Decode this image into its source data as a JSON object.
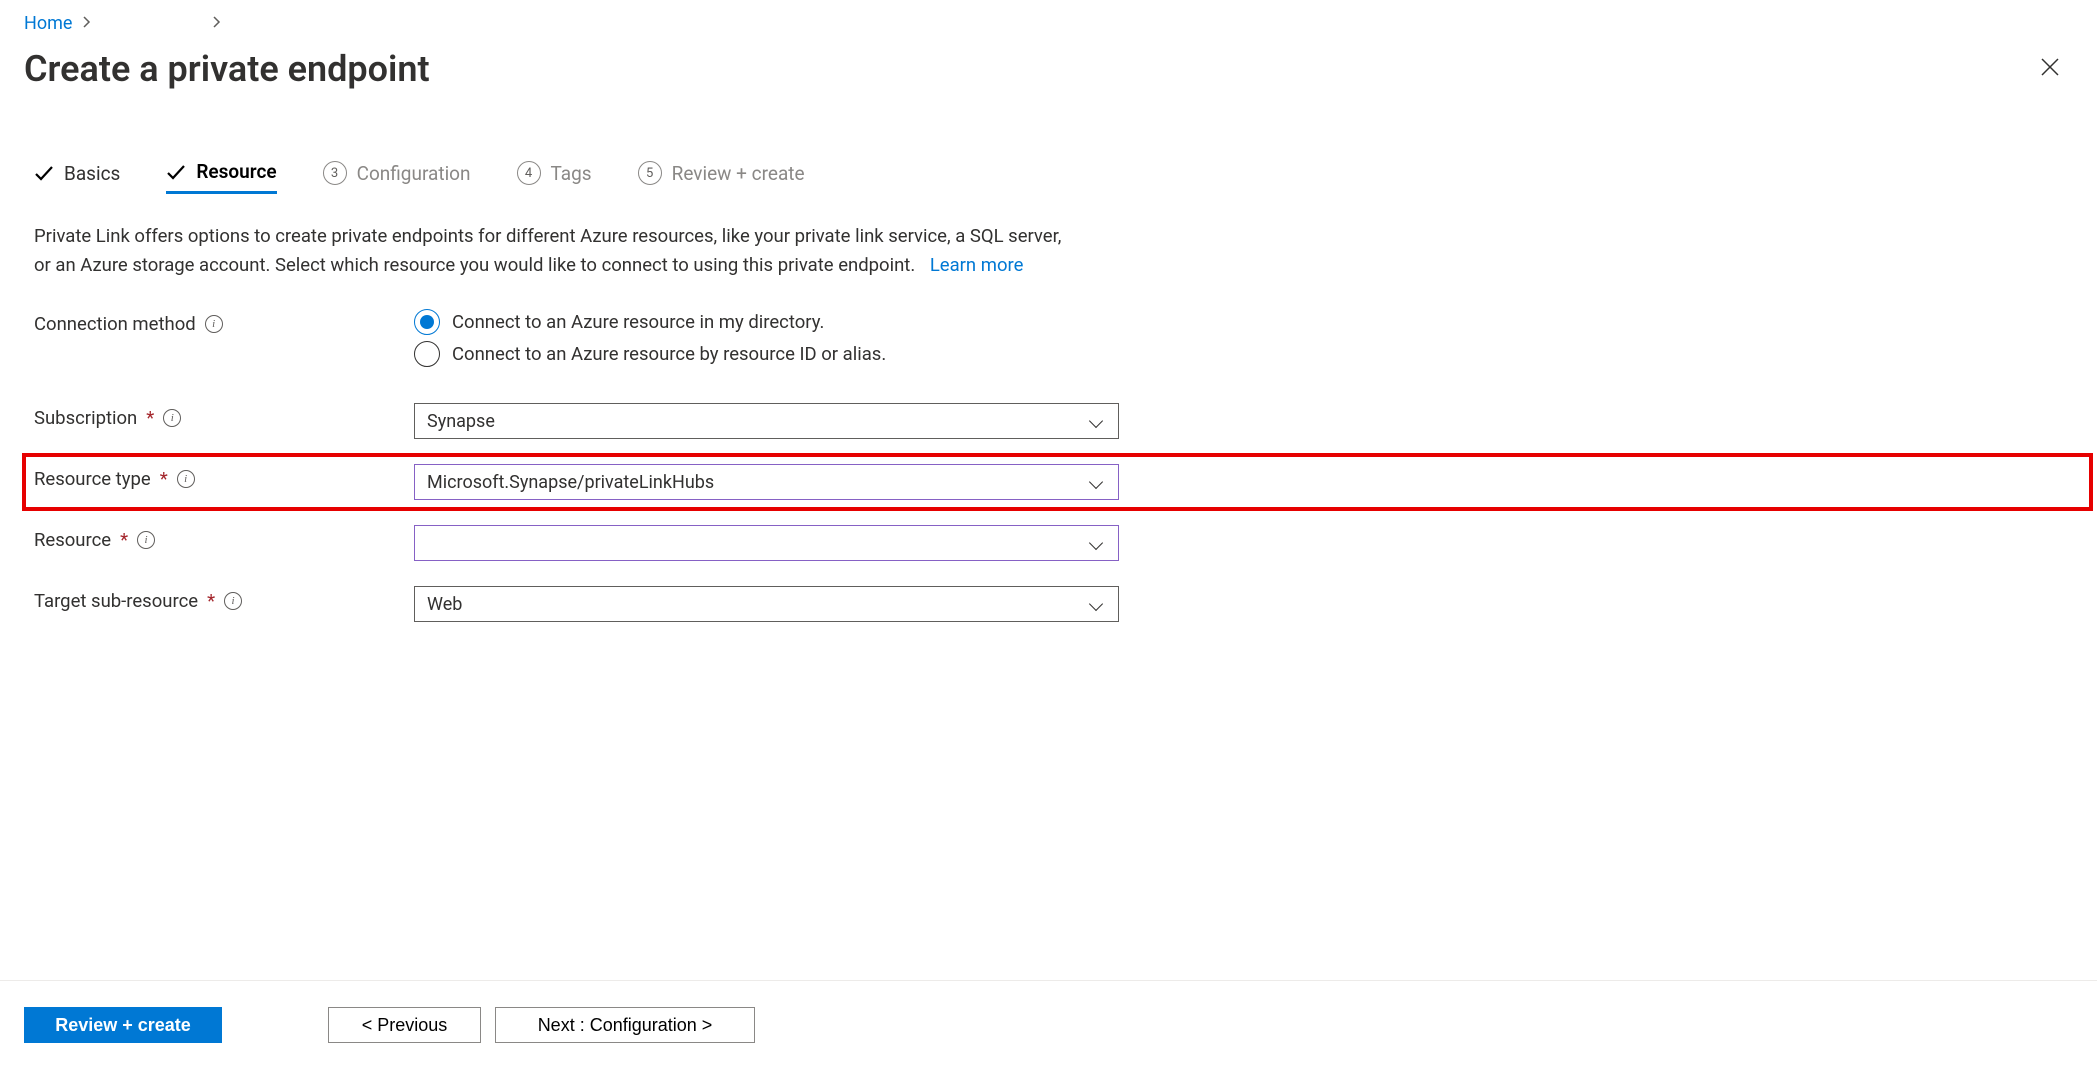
{
  "breadcrumb": {
    "home": "Home"
  },
  "header": {
    "title": "Create a private endpoint"
  },
  "tabs": {
    "basics": "Basics",
    "resource": "Resource",
    "configuration": {
      "num": "3",
      "label": "Configuration"
    },
    "tags": {
      "num": "4",
      "label": "Tags"
    },
    "review": {
      "num": "5",
      "label": "Review + create"
    }
  },
  "description_line1": "Private Link offers options to create private endpoints for different Azure resources, like your private link service, a SQL server,",
  "description_line2": "or an Azure storage account. Select which resource you would like to connect to using this private endpoint.",
  "learn_more": "Learn more",
  "labels": {
    "connection_method": "Connection method",
    "subscription": "Subscription",
    "resource_type": "Resource type",
    "resource": "Resource",
    "target_sub_resource": "Target sub-resource"
  },
  "radios": {
    "option1": "Connect to an Azure resource in my directory.",
    "option2": "Connect to an Azure resource by resource ID or alias."
  },
  "values": {
    "subscription": "Synapse",
    "resource_type": "Microsoft.Synapse/privateLinkHubs",
    "resource": "",
    "target_sub_resource": "Web"
  },
  "footer": {
    "review": "Review + create",
    "previous": "< Previous",
    "next": "Next : Configuration >"
  }
}
